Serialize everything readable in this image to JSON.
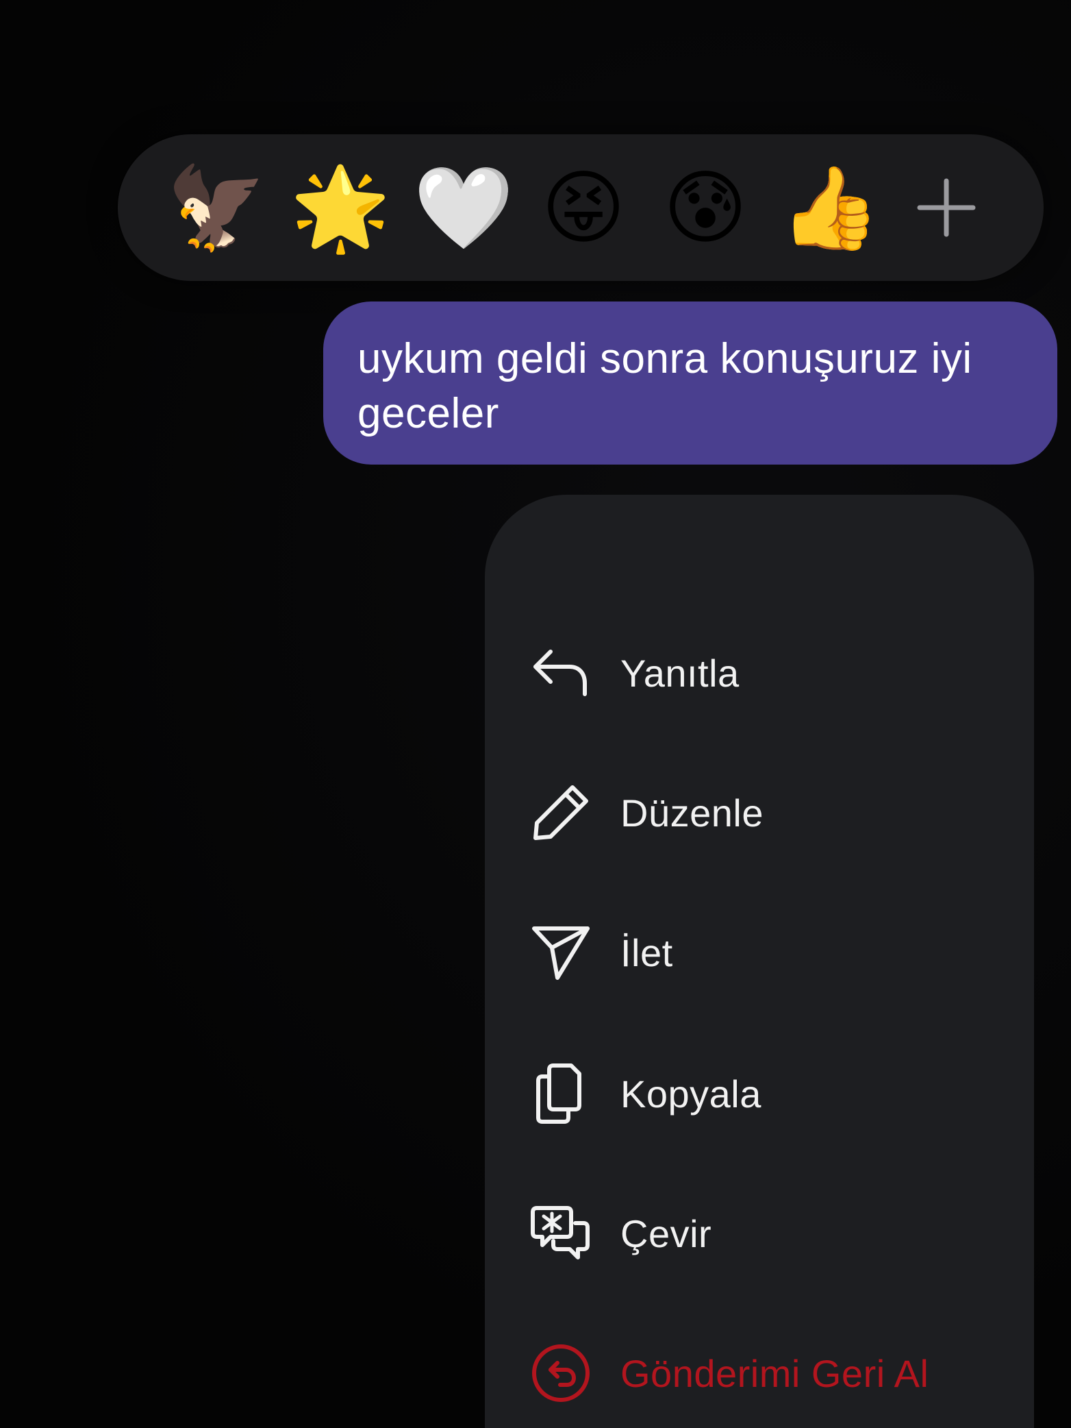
{
  "reactions": {
    "items": [
      "🦅",
      "🌟",
      "🤍",
      "😝",
      "😰",
      "👍"
    ],
    "add_icon": "plus-icon"
  },
  "message": {
    "text": "uykum geldi sonra konuşuruz iyi geceler"
  },
  "menu": {
    "reply": {
      "label": "Yanıtla",
      "icon": "reply-arrow-icon"
    },
    "edit": {
      "label": "Düzenle",
      "icon": "pencil-icon"
    },
    "forward": {
      "label": "İlet",
      "icon": "send-icon"
    },
    "copy": {
      "label": "Kopyala",
      "icon": "copy-icon"
    },
    "translate": {
      "label": "Çevir",
      "icon": "translate-icon"
    },
    "unsend": {
      "label": "Gönderimi Geri Al",
      "icon": "undo-circle-icon"
    }
  },
  "colors": {
    "background": "#050505",
    "reaction_bar": "#1b1b1d",
    "bubble": "#4a3f8f",
    "menu": "#1d1e21",
    "danger": "#b3151e"
  }
}
